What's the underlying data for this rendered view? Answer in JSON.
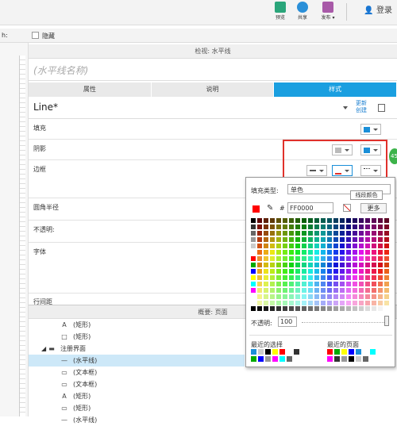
{
  "toolbar": {
    "preview": "预览",
    "share": "共享",
    "publish": "发布 ▾",
    "login": "登录"
  },
  "row2": {
    "w_label": "h:",
    "hide": "隐藏"
  },
  "inspector": {
    "header": "检视: 水平线",
    "name_placeholder": "(水平线名称)",
    "tabs": [
      "属性",
      "说明",
      "样式"
    ],
    "style_name": "Line*",
    "link1": "更新",
    "link2": "创建"
  },
  "props": {
    "fill": "填充",
    "shadow": "阴影",
    "border": "边框",
    "radius": "圆角半径",
    "opacity": "不透明:",
    "font": "字体",
    "spacing": "行间距"
  },
  "outline": {
    "header": "概要: 页面",
    "items": [
      {
        "icon": "A",
        "text": "(矩形)"
      },
      {
        "icon": "□",
        "text": "(矩形)"
      },
      {
        "icon": "▬",
        "text": "注册界面",
        "group": true
      },
      {
        "icon": "—",
        "text": "(水平线)",
        "selected": true
      },
      {
        "icon": "▭",
        "text": "(文本框)"
      },
      {
        "icon": "▭",
        "text": "(文本框)"
      },
      {
        "icon": "A",
        "text": "(矩形)"
      },
      {
        "icon": "▭",
        "text": "(矩形)"
      },
      {
        "icon": "—",
        "text": "(水平线)"
      }
    ]
  },
  "popup": {
    "fill_type_label": "填充类型:",
    "fill_type_value": "单色",
    "hex_value": "FF0000",
    "more": "更多",
    "tooltip": "线段颜色",
    "opacity_label": "不透明:",
    "opacity_value": "100",
    "recent_selection": "最近的选择",
    "recent_pages": "最近的页面"
  },
  "colors": {
    "accent": "#1a9fe0",
    "highlight": "#e0312b",
    "selected": "#ff0000"
  }
}
